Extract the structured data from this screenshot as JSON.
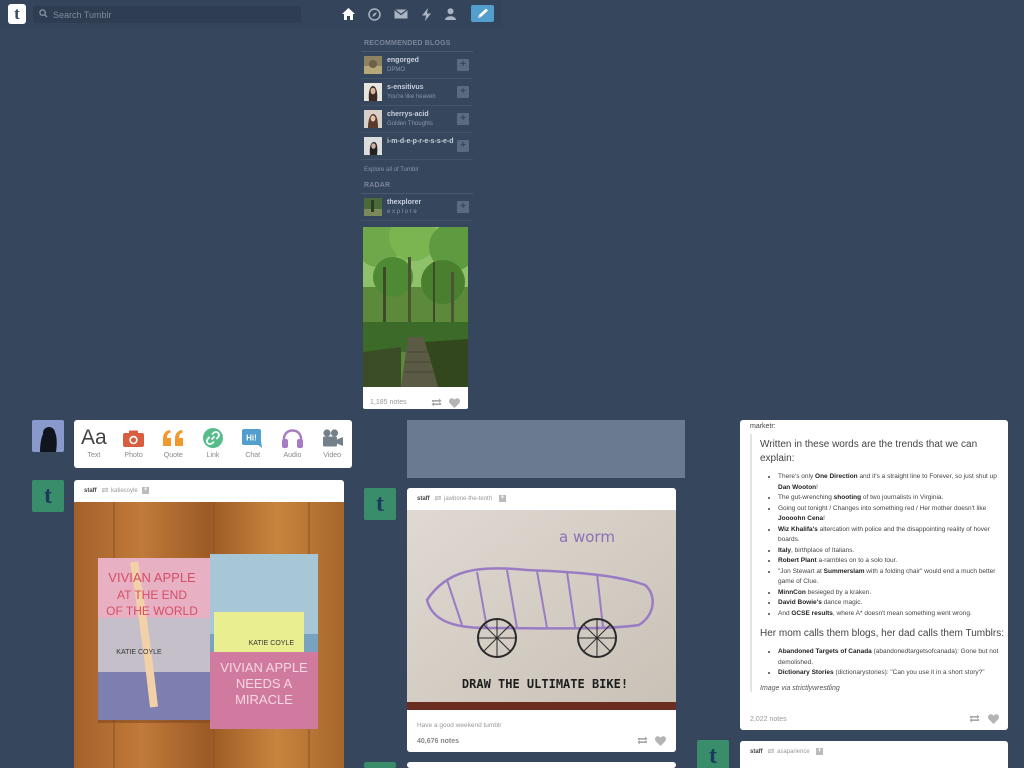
{
  "header": {
    "search_placeholder": "Search Tumblr",
    "logo": "t",
    "nav_icons": [
      "home-icon",
      "explore-compass-icon",
      "inbox-mail-icon",
      "activity-lightning-icon",
      "account-person-icon"
    ],
    "compose_icon": "pencil-icon",
    "accent": "#529ecc"
  },
  "sidebar": {
    "heading": "RECOMMENDED BLOGS",
    "blogs": [
      {
        "name": "engorged",
        "sub": "DPMO"
      },
      {
        "name": "s-ensitivus",
        "sub": "You're like heaven"
      },
      {
        "name": "cherrys-acid",
        "sub": "Golden Thoughts"
      },
      {
        "name": "i-m-d-e-p-r-e-s-s-e-d",
        "sub": ""
      }
    ],
    "explore": "Explore all of Tumblr",
    "radar_heading": "RADAR",
    "radar": {
      "name": "thexplorer",
      "sub": "e x p l o r e",
      "notes": "1,185 notes"
    }
  },
  "post_types": [
    {
      "label": "Text",
      "icon": "text-aa-icon",
      "color": "#444444"
    },
    {
      "label": "Photo",
      "icon": "camera-icon",
      "color": "#d95e40"
    },
    {
      "label": "Quote",
      "icon": "quote-icon",
      "color": "#f2992e"
    },
    {
      "label": "Link",
      "icon": "link-icon",
      "color": "#56bc8a"
    },
    {
      "label": "Chat",
      "icon": "chat-icon",
      "color": "#529ecc"
    },
    {
      "label": "Audio",
      "icon": "headphones-icon",
      "color": "#a77dc2"
    },
    {
      "label": "Video",
      "icon": "video-camera-icon",
      "color": "#748089"
    }
  ],
  "posts": {
    "left": {
      "author": "staff",
      "source": "katiecoyle"
    },
    "middle": {
      "author": "staff",
      "source": "jawbone-the-tenth",
      "caption": "Have a good weekend tumblr",
      "notes": "40,676 notes",
      "drawing_label": "a worm",
      "drawing_text": "DRAW THE ULTIMATE BIKE!"
    },
    "right": {
      "by": "marketr:",
      "heading1": "Written in these words are the trends that we can explain:",
      "items1": [
        [
          "There's only ",
          "One Direction",
          " and it's a straight line to Forever, so just shut up ",
          "Dan Wooton",
          "!"
        ],
        [
          "The gut-wrenching ",
          "shooting",
          " of two journalists in Virginia.",
          "",
          ""
        ],
        [
          "Going out tonight / Changes into something red / Her mother doesn't like ",
          "Joooohn Cena",
          "!",
          "",
          ""
        ],
        [
          "",
          "Wiz Khalifa's",
          " altercation with police and the disappointing reality of hover boards.",
          "",
          ""
        ],
        [
          "",
          "Italy",
          ", birthplace of Italians.",
          "",
          ""
        ],
        [
          "",
          "Robert Plant",
          " a-rambles on to a solo tour.",
          "",
          ""
        ],
        [
          "\"Jon Stewart at ",
          "Summerslam",
          " with a folding chair\" would end a much better game of Clue.",
          "",
          ""
        ],
        [
          "",
          "MinnCon",
          " besieged by a kraken.",
          "",
          ""
        ],
        [
          "",
          "David Bowie's",
          " dance magic.",
          "",
          ""
        ],
        [
          "And ",
          "GCSE results",
          ", where A* doesn't mean something went wrong.",
          "",
          ""
        ]
      ],
      "heading2": "Her mom calls them blogs, her dad calls them Tumblrs:",
      "items2": [
        [
          "",
          "Abandoned Targets of Canada",
          " (abandonedtargetsofcanada): Gone but not demolished."
        ],
        [
          "",
          "Dictionary Stories",
          " (dictionarystories): \"Can you use it in a short story?\""
        ]
      ],
      "credit": "Image via strictlywrestling",
      "notes": "2,022 notes"
    },
    "bottom_right": {
      "author": "staff",
      "source": "asaparience"
    }
  },
  "book_titles": {
    "book1_title": "VIVIAN APPLE AT THE END OF THE WORLD",
    "book1_author": "KATIE COYLE",
    "book2_title": "VIVIAN APPLE NEEDS A MIRACLE",
    "book2_author": "KATIE COYLE"
  }
}
